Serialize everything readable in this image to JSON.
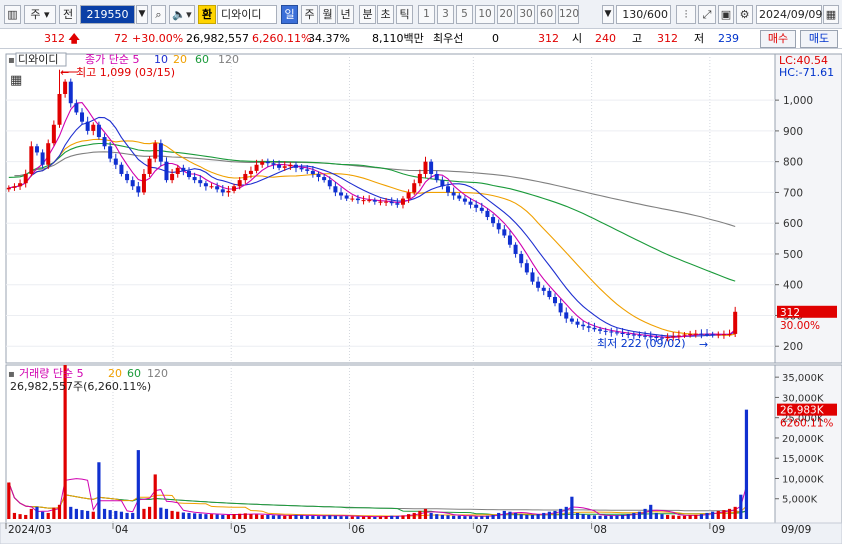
{
  "toolbar": {
    "market_mode": "주",
    "scope": "전",
    "code": "219550",
    "badge": "환",
    "stock_name": "디와이디",
    "periods": [
      "일",
      "주",
      "월",
      "년",
      "분",
      "초",
      "틱"
    ],
    "active_period": "일",
    "intervals": [
      "1",
      "3",
      "5",
      "10",
      "20",
      "30",
      "60",
      "120"
    ],
    "bar_count": "130",
    "bar_total": "/600",
    "date": "2024/09/09"
  },
  "info": {
    "price": "312",
    "change": "72",
    "change_pct": "+30.00%",
    "volume": "26,982,557",
    "volume_pct": "6,260.11%",
    "turnover": "34.37%",
    "amount": "8,110백만",
    "preferred_label": "최우선",
    "preferred_value": "0",
    "best": "312",
    "open_label": "시",
    "open": "240",
    "high_label": "고",
    "high": "312",
    "low_label": "저",
    "low": "239",
    "buy_label": "매수",
    "sell_label": "매도"
  },
  "price_panel": {
    "name": "디와이디",
    "ma_label": "종가 단순 5",
    "ma_periods": [
      "10",
      "20",
      "60",
      "120"
    ],
    "ma_colors": {
      "5": "#d000b0",
      "10": "#1f2fd0",
      "20": "#f0a000",
      "60": "#1a9a3a",
      "120": "#808080"
    },
    "lc": "LC:40.54",
    "hc": "HC:-71.61",
    "high_annotation": "최고 1,099 (03/15)",
    "low_annotation": "최저 222 (09/02)",
    "current_price": "312",
    "current_pct": "30.00%",
    "y_ticks": [
      "1,000",
      "900",
      "800",
      "700",
      "600",
      "500",
      "400",
      "300",
      "200"
    ],
    "y_values": [
      1000,
      900,
      800,
      700,
      600,
      500,
      400,
      300,
      200
    ]
  },
  "volume_panel": {
    "label": "거래량 단순 5",
    "ma_periods": [
      "20",
      "60",
      "120"
    ],
    "last_value_text": "26,982,557주(6,260.11%)",
    "current_volume": "26,983K",
    "current_pct": "6260.11%",
    "y_ticks": [
      "35,000K",
      "30,000K",
      "25,000K",
      "20,000K",
      "15,000K",
      "10,000K",
      "5,000K"
    ],
    "y_values": [
      35000,
      30000,
      25000,
      20000,
      15000,
      10000,
      5000
    ]
  },
  "x_axis": {
    "labels": [
      "2024/03",
      "04",
      "05",
      "06",
      "07",
      "08",
      "09"
    ],
    "right_label": "09/09"
  },
  "chart_data": {
    "type": "candlestick",
    "price_range": [
      165,
      1150
    ],
    "volume_range": [
      0,
      38000
    ],
    "volume_unit": "K",
    "months": [
      "2024/03",
      "04",
      "05",
      "06",
      "07",
      "08",
      "09"
    ],
    "candle_count": 130,
    "spikes": [
      {
        "index": 9,
        "close": 1099,
        "high": 1099,
        "volume": 38000
      },
      {
        "index": 17,
        "close": 960,
        "volume": 14000
      },
      {
        "index": 24,
        "close": 780,
        "volume": 17000
      },
      {
        "index": 27,
        "close": 730,
        "volume": 11000
      },
      {
        "index": 129,
        "close": 312,
        "volume": 26983
      }
    ],
    "closes": [
      715,
      720,
      730,
      760,
      850,
      830,
      790,
      860,
      920,
      1020,
      1060,
      990,
      960,
      930,
      900,
      920,
      880,
      850,
      810,
      790,
      760,
      740,
      720,
      700,
      760,
      810,
      860,
      800,
      740,
      760,
      780,
      770,
      750,
      740,
      730,
      720,
      720,
      710,
      700,
      705,
      720,
      740,
      760,
      770,
      790,
      800,
      795,
      790,
      780,
      785,
      790,
      780,
      775,
      770,
      760,
      750,
      740,
      720,
      700,
      690,
      680,
      680,
      675,
      675,
      675,
      670,
      670,
      670,
      665,
      660,
      680,
      700,
      730,
      760,
      800,
      760,
      740,
      720,
      700,
      690,
      680,
      670,
      660,
      650,
      640,
      620,
      600,
      580,
      560,
      530,
      500,
      470,
      440,
      410,
      390,
      380,
      360,
      340,
      310,
      290,
      280,
      270,
      265,
      260,
      255,
      250,
      248,
      245,
      243,
      240,
      238,
      236,
      234,
      232,
      230,
      228,
      226,
      230,
      232,
      235,
      238,
      240,
      241,
      240,
      239,
      238,
      238,
      239,
      240,
      312
    ],
    "volumes": [
      9000,
      1500,
      1200,
      1000,
      2500,
      3000,
      1800,
      1500,
      2800,
      3500,
      38000,
      3000,
      2500,
      2200,
      2000,
      1800,
      14000,
      2500,
      2200,
      2000,
      1800,
      1500,
      1500,
      17000,
      2500,
      3000,
      11000,
      2800,
      2500,
      2000,
      1800,
      1600,
      1500,
      1400,
      1300,
      1200,
      1200,
      1100,
      1000,
      1000,
      1200,
      1300,
      1400,
      1200,
      1100,
      1000,
      1000,
      900,
      900,
      800,
      900,
      1000,
      900,
      800,
      800,
      700,
      800,
      900,
      800,
      700,
      700,
      600,
      600,
      600,
      600,
      500,
      600,
      700,
      800,
      700,
      900,
      1200,
      1500,
      2000,
      2500,
      1500,
      1200,
      1000,
      900,
      800,
      800,
      700,
      700,
      600,
      700,
      800,
      1000,
      1500,
      2000,
      1800,
      1500,
      1200,
      1000,
      1000,
      1200,
      1500,
      1800,
      2000,
      2500,
      3000,
      5500,
      1500,
      1200,
      1000,
      900,
      800,
      800,
      800,
      900,
      1000,
      1200,
      1500,
      1800,
      2500,
      3500,
      1500,
      1200,
      1000,
      900,
      800,
      800,
      900,
      1000,
      1200,
      1500,
      1800,
      2000,
      2200,
      2500,
      3000,
      6000,
      26983
    ]
  }
}
